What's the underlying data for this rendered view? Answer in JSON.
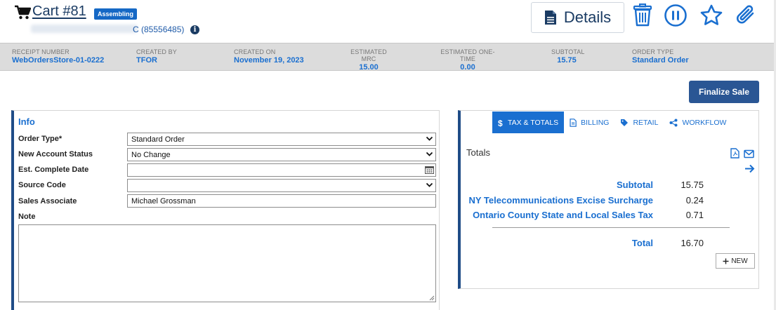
{
  "header": {
    "cart_title": "Cart #81",
    "status_badge": "Assembling",
    "customer_suffix": "C (85556485)",
    "details_label": "Details"
  },
  "summary": [
    {
      "label": "RECEIPT NUMBER",
      "value": "WebOrdersStore-01-0222"
    },
    {
      "label": "CREATED BY",
      "value": "TFOR"
    },
    {
      "label": "CREATED ON",
      "value": "November 19, 2023"
    },
    {
      "label": "ESTIMATED MRC",
      "value": "15.00"
    },
    {
      "label": "ESTIMATED ONE-TIME",
      "value": "0.00"
    },
    {
      "label": "SUBTOTAL",
      "value": "15.75"
    },
    {
      "label": "ORDER TYPE",
      "value": "Standard Order"
    }
  ],
  "actions": {
    "finalize_label": "Finalize Sale"
  },
  "info": {
    "title": "Info",
    "fields": [
      {
        "label": "Order Type*",
        "value": "Standard Order"
      },
      {
        "label": "New Account Status",
        "value": "No Change"
      },
      {
        "label": "Est. Complete Date",
        "value": ""
      },
      {
        "label": "Source Code",
        "value": ""
      },
      {
        "label": "Sales Associate",
        "value": "Michael Grossman"
      }
    ],
    "note_label": "Note",
    "note_value": ""
  },
  "totals_panel": {
    "tabs": [
      {
        "label": "TAX & TOTALS",
        "icon": "dollar-icon",
        "active": true
      },
      {
        "label": "BILLING",
        "icon": "document-icon",
        "active": false
      },
      {
        "label": "RETAIL",
        "icon": "tag-icon",
        "active": false
      },
      {
        "label": "WORKFLOW",
        "icon": "workflow-icon",
        "active": false
      }
    ],
    "heading": "Totals",
    "rows": [
      {
        "label": "Subtotal",
        "value": "15.75"
      },
      {
        "label": "NY Telecommunications Excise Surcharge",
        "value": "0.24"
      },
      {
        "label": "Ontario County State and Local Sales Tax",
        "value": "0.71"
      }
    ],
    "total_label": "Total",
    "total_value": "16.70",
    "new_label": "NEW"
  },
  "colors": {
    "accent": "#1a6fd0",
    "navy": "#1f4c87",
    "badge": "#1568c5"
  }
}
